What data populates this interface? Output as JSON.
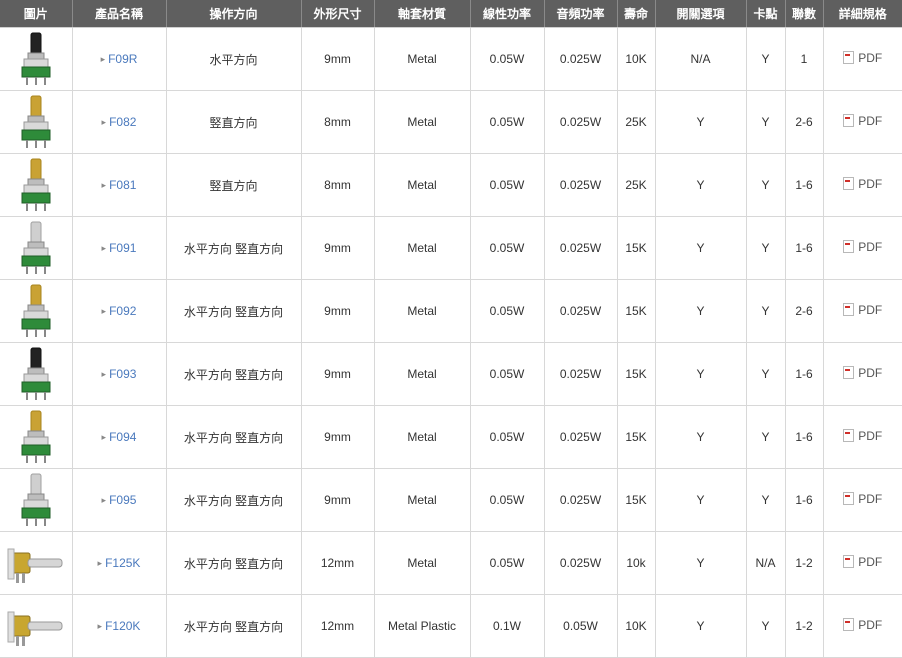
{
  "columns": [
    "圖片",
    "產品名稱",
    "操作方向",
    "外形尺寸",
    "軸套材質",
    "線性功率",
    "音頻功率",
    "壽命",
    "開關選項",
    "卡點",
    "聯數",
    "詳細規格"
  ],
  "colors": {
    "header_bg": "#5f5f5f",
    "link": "#4a79bd",
    "border": "#d8d8d8",
    "pcb_green": "#2e8b3a"
  },
  "rows": [
    {
      "name": "F09R",
      "direction": "水平方向",
      "size": "9mm",
      "material": "Metal",
      "linear": "0.05W",
      "audio": "0.025W",
      "life": "10K",
      "switch": "N/A",
      "detent": "Y",
      "gang": "1",
      "spec": "PDF",
      "image": "potentiometer-black-knob-icon"
    },
    {
      "name": "F082",
      "direction": "竪直方向",
      "size": "8mm",
      "material": "Metal",
      "linear": "0.05W",
      "audio": "0.025W",
      "life": "25K",
      "switch": "Y",
      "detent": "Y",
      "gang": "2-6",
      "spec": "PDF",
      "image": "potentiometer-gold-shaft-icon"
    },
    {
      "name": "F081",
      "direction": "竪直方向",
      "size": "8mm",
      "material": "Metal",
      "linear": "0.05W",
      "audio": "0.025W",
      "life": "25K",
      "switch": "Y",
      "detent": "Y",
      "gang": "1-6",
      "spec": "PDF",
      "image": "potentiometer-gold-shaft-icon"
    },
    {
      "name": "F091",
      "direction": "水平方向 竪直方向",
      "size": "9mm",
      "material": "Metal",
      "linear": "0.05W",
      "audio": "0.025W",
      "life": "15K",
      "switch": "Y",
      "detent": "Y",
      "gang": "1-6",
      "spec": "PDF",
      "image": "potentiometer-silver-shaft-icon"
    },
    {
      "name": "F092",
      "direction": "水平方向 竪直方向",
      "size": "9mm",
      "material": "Metal",
      "linear": "0.05W",
      "audio": "0.025W",
      "life": "15K",
      "switch": "Y",
      "detent": "Y",
      "gang": "2-6",
      "spec": "PDF",
      "image": "potentiometer-gold-shaft-icon"
    },
    {
      "name": "F093",
      "direction": "水平方向 竪直方向",
      "size": "9mm",
      "material": "Metal",
      "linear": "0.05W",
      "audio": "0.025W",
      "life": "15K",
      "switch": "Y",
      "detent": "Y",
      "gang": "1-6",
      "spec": "PDF",
      "image": "potentiometer-black-knob-icon"
    },
    {
      "name": "F094",
      "direction": "水平方向 竪直方向",
      "size": "9mm",
      "material": "Metal",
      "linear": "0.05W",
      "audio": "0.025W",
      "life": "15K",
      "switch": "Y",
      "detent": "Y",
      "gang": "1-6",
      "spec": "PDF",
      "image": "potentiometer-gold-shaft-icon"
    },
    {
      "name": "F095",
      "direction": "水平方向 竪直方向",
      "size": "9mm",
      "material": "Metal",
      "linear": "0.05W",
      "audio": "0.025W",
      "life": "15K",
      "switch": "Y",
      "detent": "Y",
      "gang": "1-6",
      "spec": "PDF",
      "image": "potentiometer-silver-shaft-icon"
    },
    {
      "name": "F125K",
      "direction": "水平方向 竪直方向",
      "size": "12mm",
      "material": "Metal",
      "linear": "0.05W",
      "audio": "0.025W",
      "life": "10k",
      "switch": "Y",
      "detent": "N/A",
      "gang": "1-2",
      "spec": "PDF",
      "image": "potentiometer-horizontal-icon"
    },
    {
      "name": "F120K",
      "direction": "水平方向 竪直方向",
      "size": "12mm",
      "material": "Metal Plastic",
      "linear": "0.1W",
      "audio": "0.05W",
      "life": "10K",
      "switch": "Y",
      "detent": "Y",
      "gang": "1-2",
      "spec": "PDF",
      "image": "potentiometer-horizontal-icon"
    }
  ]
}
